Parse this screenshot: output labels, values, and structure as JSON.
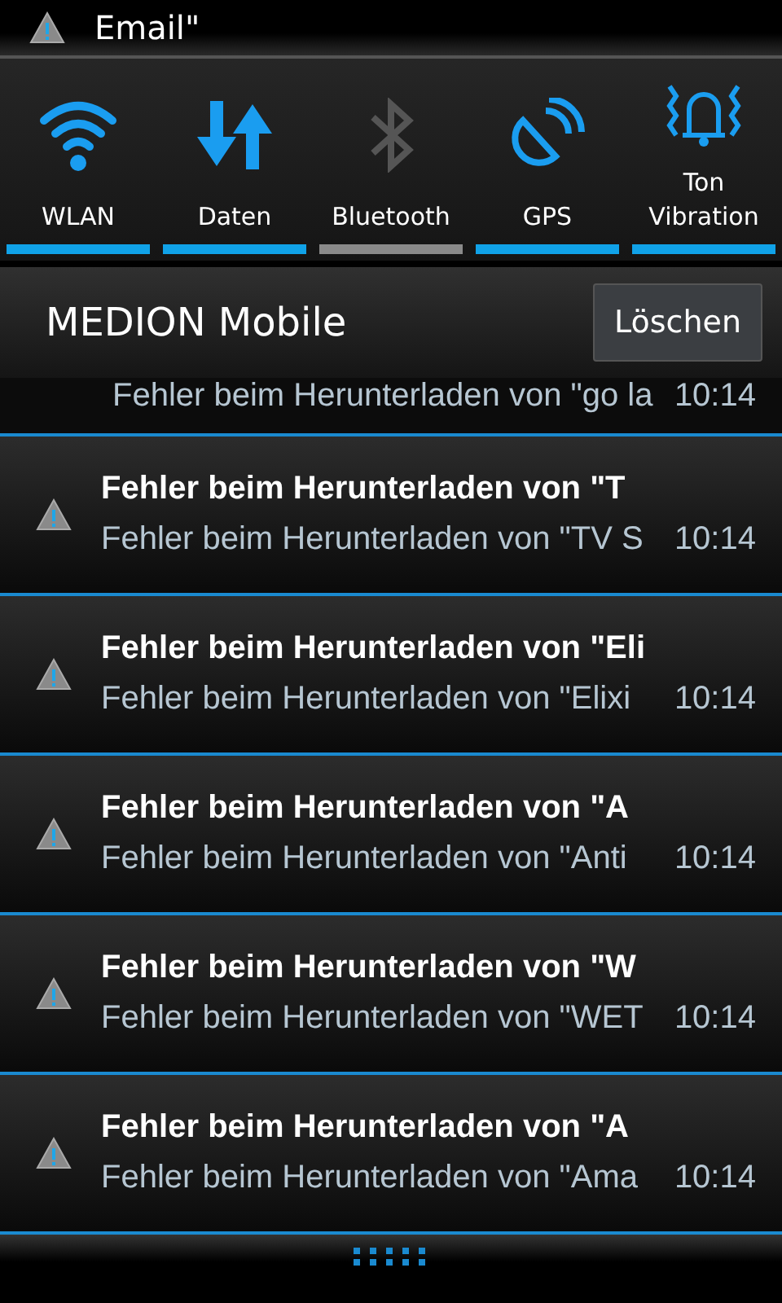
{
  "status_bar": {
    "ticker": "Email\""
  },
  "toggles": [
    {
      "kind": "wifi",
      "label": "WLAN",
      "on": true
    },
    {
      "kind": "data",
      "label": "Daten",
      "on": true
    },
    {
      "kind": "bluetooth",
      "label": "Bluetooth",
      "on": false
    },
    {
      "kind": "gps",
      "label": "GPS",
      "on": true
    },
    {
      "kind": "sound",
      "label": "Ton Vibration",
      "on": true
    }
  ],
  "group": {
    "title": "MEDION Mobile",
    "clear_button": "Löschen"
  },
  "partial_notification": {
    "text": "Fehler beim Herunterladen von \"go la",
    "time": "10:14"
  },
  "notifications": [
    {
      "title": "Fehler beim Herunterladen von \"T",
      "text": "Fehler beim Herunterladen von \"TV S",
      "time": "10:14"
    },
    {
      "title": "Fehler beim Herunterladen von \"Eli",
      "text": "Fehler beim Herunterladen von \"Elixi",
      "time": "10:14"
    },
    {
      "title": "Fehler beim Herunterladen von \"A",
      "text": "Fehler beim Herunterladen von \"Anti",
      "time": "10:14"
    },
    {
      "title": "Fehler beim Herunterladen von \"W",
      "text": "Fehler beim Herunterladen von \"WET",
      "time": "10:14"
    },
    {
      "title": "Fehler beim Herunterladen von \"A",
      "text": "Fehler beim Herunterladen von \"Ama",
      "time": "10:14"
    }
  ]
}
